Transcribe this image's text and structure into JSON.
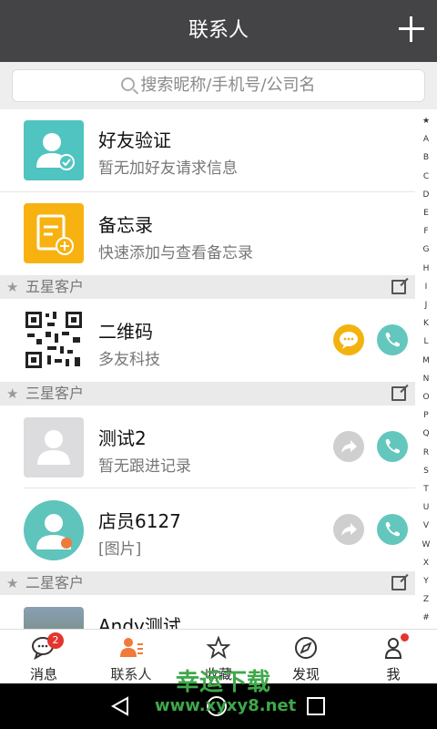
{
  "header": {
    "title": "联系人",
    "add_icon": "plus-icon"
  },
  "search": {
    "placeholder": "搜索昵称/手机号/公司名",
    "icon": "search-icon"
  },
  "special_rows": [
    {
      "name": "好友验证",
      "sub": "暂无加好友请求信息",
      "icon": "user-verify-icon",
      "color": "#4fc4c0"
    },
    {
      "name": "备忘录",
      "sub": "快速添加与查看备忘录",
      "icon": "memo-icon",
      "color": "#f7b211"
    }
  ],
  "sections": [
    {
      "title": "五星客户",
      "contacts": [
        {
          "name": "二维码",
          "sub": "多友科技",
          "actions": [
            "message-icon",
            "phone-icon"
          ]
        }
      ]
    },
    {
      "title": "三星客户",
      "contacts": [
        {
          "name": "测试2",
          "sub": "暂无跟进记录",
          "actions": [
            "forward-icon",
            "phone-icon"
          ]
        },
        {
          "name": "店员6127",
          "sub": "[图片]",
          "actions": [
            "forward-icon",
            "phone-icon"
          ]
        }
      ]
    },
    {
      "title": "二星客户",
      "contacts": [
        {
          "name": "Andy测试",
          "sub": ""
        }
      ]
    }
  ],
  "alpha_index": [
    "★",
    "A",
    "B",
    "C",
    "D",
    "E",
    "F",
    "G",
    "H",
    "I",
    "J",
    "K",
    "L",
    "M",
    "N",
    "O",
    "P",
    "Q",
    "R",
    "S",
    "T",
    "U",
    "V",
    "W",
    "X",
    "Y",
    "Z",
    "#"
  ],
  "tabs": [
    {
      "label": "消息",
      "badge": "2"
    },
    {
      "label": "联系人"
    },
    {
      "label": "收藏"
    },
    {
      "label": "发现"
    },
    {
      "label": "我"
    }
  ],
  "watermark": {
    "line1": "幸运下载",
    "line2": "www.xyxy8.net"
  },
  "colors": {
    "header_bg": "#444446",
    "teal": "#63c7bd",
    "orange": "#f3b30e",
    "badge_red": "#e3352f",
    "accent_active": "#f07a3a"
  }
}
